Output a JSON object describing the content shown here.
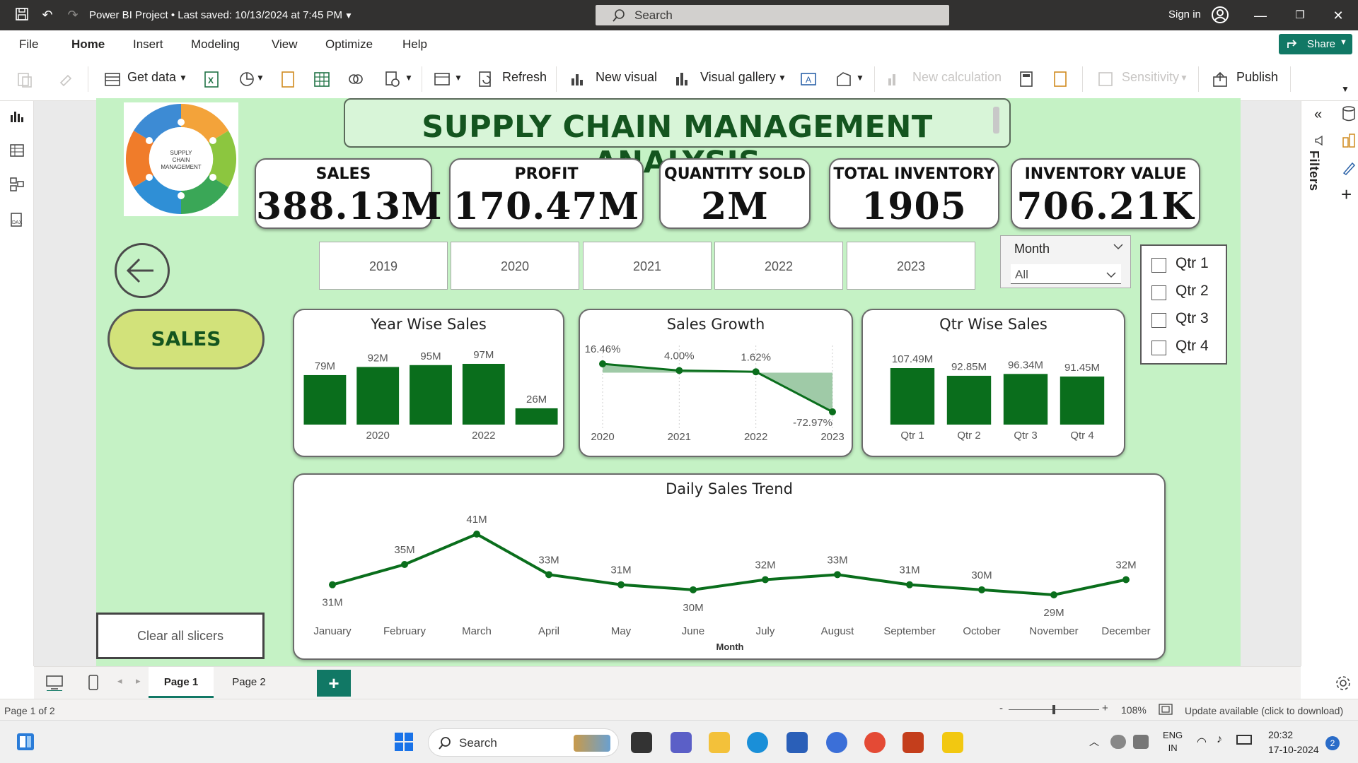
{
  "window": {
    "app_title": "Power BI Project • Last saved: 10/13/2024 at 7:45 PM",
    "search_placeholder": "Search",
    "sign_in": "Sign in"
  },
  "menu": [
    "File",
    "Home",
    "Insert",
    "Modeling",
    "View",
    "Optimize",
    "Help"
  ],
  "share_label": "Share",
  "ribbon": {
    "get_data": "Get data",
    "refresh": "Refresh",
    "new_visual": "New visual",
    "visual_gallery": "Visual gallery",
    "new_calculation": "New calculation",
    "sensitivity": "Sensitivity",
    "publish": "Publish"
  },
  "filters_label": "Filters",
  "report": {
    "title": "SUPPLY CHAIN MANAGEMENT ANALYSIS",
    "logo_text": "SUPPLY CHAIN MANAGEMENT",
    "kpis": [
      {
        "label": "SALES",
        "value": "388.13M"
      },
      {
        "label": "PROFIT",
        "value": "170.47M"
      },
      {
        "label": "QUANTITY SOLD",
        "value": "2M"
      },
      {
        "label": "TOTAL INVENTORY",
        "value": "1905"
      },
      {
        "label": "INVENTORY VALUE",
        "value": "706.21K"
      }
    ],
    "years": [
      "2019",
      "2020",
      "2021",
      "2022",
      "2023"
    ],
    "month_slicer": {
      "title": "Month",
      "value": "All"
    },
    "quarters": [
      "Qtr 1",
      "Qtr 2",
      "Qtr 3",
      "Qtr 4"
    ],
    "sales_button": "SALES",
    "clear_button": "Clear all slicers",
    "accent_color": "#0a6e1c"
  },
  "chart_data": [
    {
      "type": "bar",
      "title": "Year Wise Sales",
      "categories": [
        "2019",
        "2020",
        "2021",
        "2022",
        "2023"
      ],
      "visible_tick_labels": [
        "2020",
        "2022"
      ],
      "values": [
        79,
        92,
        95,
        97,
        26
      ],
      "data_labels": [
        "79M",
        "92M",
        "95M",
        "97M",
        "26M"
      ]
    },
    {
      "type": "area",
      "title": "Sales Growth",
      "categories": [
        "2020",
        "2021",
        "2022",
        "2023"
      ],
      "values": [
        16.46,
        4.0,
        1.62,
        -72.97
      ],
      "data_labels": [
        "16.46%",
        "4.00%",
        "1.62%",
        "-72.97%"
      ]
    },
    {
      "type": "bar",
      "title": "Qtr Wise Sales",
      "categories": [
        "Qtr 1",
        "Qtr 2",
        "Qtr 3",
        "Qtr 4"
      ],
      "values": [
        107.49,
        92.85,
        96.34,
        91.45
      ],
      "data_labels": [
        "107.49M",
        "92.85M",
        "96.34M",
        "91.45M"
      ]
    },
    {
      "type": "line",
      "title": "Daily Sales Trend",
      "xlabel": "Month",
      "categories": [
        "January",
        "February",
        "March",
        "April",
        "May",
        "June",
        "July",
        "August",
        "September",
        "October",
        "November",
        "December"
      ],
      "values": [
        31,
        35,
        41,
        33,
        31,
        30,
        32,
        33,
        31,
        30,
        29,
        32
      ],
      "data_labels": [
        "31M",
        "35M",
        "41M",
        "33M",
        "31M",
        "30M",
        "32M",
        "33M",
        "31M",
        "30M",
        "29M",
        "32M"
      ]
    }
  ],
  "pages": {
    "tabs": [
      "Page 1",
      "Page 2"
    ],
    "add": "+"
  },
  "status": {
    "page_count": "Page 1 of 2",
    "zoom": "108%",
    "update": "Update available (click to download)"
  },
  "taskbar": {
    "search": "Search",
    "lang_line1": "ENG",
    "lang_line2": "IN",
    "time": "20:32",
    "date": "17-10-2024",
    "badge": "2"
  }
}
